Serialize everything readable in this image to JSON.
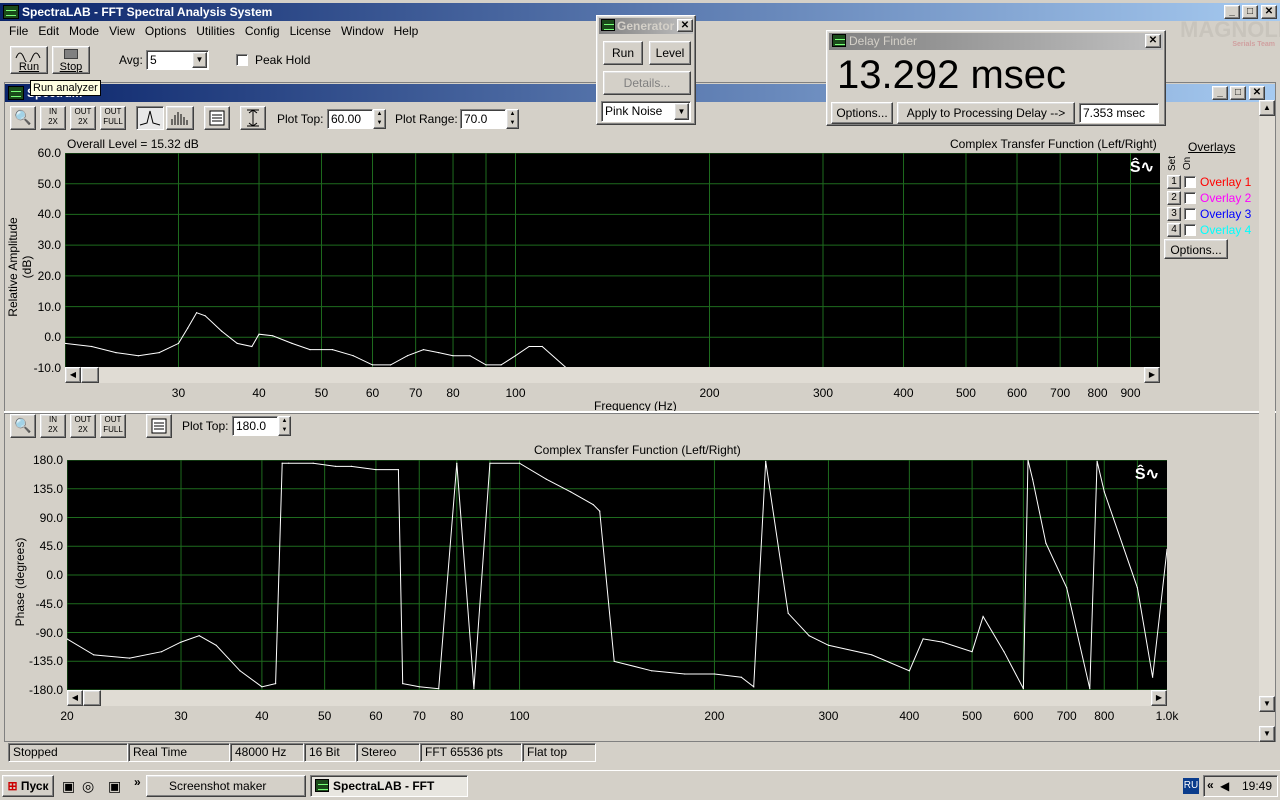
{
  "app": {
    "title": "SpectraLAB - FFT Spectral Analysis System"
  },
  "menu": [
    "File",
    "Edit",
    "Mode",
    "View",
    "Options",
    "Utilities",
    "Config",
    "License",
    "Window",
    "Help"
  ],
  "toolbar": {
    "run_label": "Run",
    "stop_label": "Stop",
    "avg_label": "Avg:",
    "avg_value": "5",
    "peak_hold_label": "Peak Hold",
    "tooltip": "Run analyzer"
  },
  "generator": {
    "title": "Generator",
    "run": "Run",
    "level": "Level",
    "details": "Details...",
    "signal": "Pink Noise"
  },
  "delay_finder": {
    "title": "Delay Finder",
    "value": "13.292 msec",
    "options": "Options...",
    "apply": "Apply to Processing Delay -->",
    "field": "7.353 msec"
  },
  "watermark": {
    "brand": "MAGNOLIA",
    "sub": "Serials Team"
  },
  "spectrum": {
    "title": "Spectrum",
    "plot_top_label": "Plot Top:",
    "plot_top": "60.00",
    "plot_range_label": "Plot Range:",
    "plot_range": "70.0",
    "overall_level": "Overall Level = 15.32 dB",
    "chart_title": "Complex Transfer Function (Left/Right)",
    "ylabel": "Relative Amplitude (dB)",
    "xlabel": "Frequency (Hz)",
    "yticks": [
      "60.0",
      "50.0",
      "40.0",
      "30.0",
      "20.0",
      "10.0",
      "0.0",
      "-10.0"
    ],
    "xticks": [
      "30",
      "40",
      "50",
      "60",
      "70",
      "80",
      "100",
      "200",
      "300",
      "400",
      "500",
      "600",
      "700",
      "800",
      "900"
    ]
  },
  "overlays": {
    "title": "Overlays",
    "set_label": "Set",
    "on_label": "On",
    "items": [
      {
        "num": "1",
        "name": "Overlay 1",
        "color": "#ff0000"
      },
      {
        "num": "2",
        "name": "Overlay 2",
        "color": "#ff00ff"
      },
      {
        "num": "3",
        "name": "Overlay 3",
        "color": "#0000ff"
      },
      {
        "num": "4",
        "name": "Overlay 4",
        "color": "#00ffff"
      }
    ],
    "options": "Options..."
  },
  "phase": {
    "plot_top_label": "Plot Top:",
    "plot_top": "180.0",
    "chart_title": "Complex Transfer Function (Left/Right)",
    "ylabel": "Phase (degrees)",
    "yticks": [
      "180.0",
      "135.0",
      "90.0",
      "45.0",
      "0.0",
      "-45.0",
      "-90.0",
      "-135.0",
      "-180.0"
    ],
    "xticks": [
      "20",
      "30",
      "40",
      "50",
      "60",
      "70",
      "80",
      "100",
      "200",
      "300",
      "400",
      "500",
      "600",
      "700",
      "800",
      "1.0k"
    ]
  },
  "status": [
    "Stopped",
    "Real Time",
    "48000 Hz",
    "16 Bit",
    "Stereo",
    "FFT 65536 pts",
    "Flat top"
  ],
  "taskbar": {
    "start": "Пуск",
    "item1": "Screenshot maker",
    "item2": "SpectraLAB - FFT Spe...",
    "lang": "RU",
    "clock": "19:49"
  },
  "chart_data": [
    {
      "type": "line",
      "title": "Complex Transfer Function (Left/Right)",
      "xlabel": "Frequency (Hz)",
      "ylabel": "Relative Amplitude (dB)",
      "xscale": "log",
      "ylim": [
        -10,
        60
      ],
      "grid": true,
      "x": [
        20,
        22,
        24,
        26,
        28,
        30,
        31,
        32,
        33,
        35,
        37,
        39,
        40,
        42,
        45,
        48,
        52,
        56,
        60,
        64,
        68,
        72,
        76,
        80,
        85,
        90,
        95,
        100,
        105,
        110,
        120
      ],
      "y": [
        -2,
        -3,
        -5,
        -6,
        -5,
        -2,
        3,
        8,
        7,
        2,
        -2,
        -3,
        1,
        0.5,
        -2,
        -4,
        -4,
        -6,
        -9,
        -9,
        -6,
        -4,
        -5,
        -6,
        -6,
        -9,
        -9,
        -6,
        -3,
        -3,
        -10
      ]
    },
    {
      "type": "line",
      "title": "Complex Transfer Function (Left/Right)",
      "ylabel": "Phase (degrees)",
      "xscale": "log",
      "ylim": [
        -180,
        180
      ],
      "grid": true,
      "x": [
        20,
        22,
        25,
        28,
        30,
        32,
        34,
        37,
        40,
        42,
        43,
        44,
        48,
        52,
        55,
        60,
        65,
        66,
        70,
        75,
        80,
        85,
        90,
        100,
        110,
        120,
        130,
        133,
        140,
        160,
        180,
        200,
        220,
        230,
        240,
        260,
        280,
        300,
        350,
        400,
        420,
        450,
        500,
        520,
        560,
        600,
        610,
        620,
        650,
        700,
        760,
        780,
        800,
        900,
        950,
        1000
      ],
      "y": [
        -100,
        -125,
        -130,
        -120,
        -105,
        -95,
        -110,
        -150,
        -175,
        -170,
        175,
        175,
        175,
        170,
        170,
        165,
        165,
        -170,
        -175,
        -178,
        175,
        -178,
        175,
        175,
        150,
        130,
        110,
        100,
        -135,
        -150,
        -155,
        -155,
        -160,
        -175,
        178,
        -60,
        -95,
        -110,
        -125,
        -150,
        -100,
        -105,
        -120,
        -65,
        -120,
        -178,
        180,
        150,
        50,
        -20,
        -178,
        178,
        130,
        -20,
        -160,
        40
      ]
    }
  ]
}
